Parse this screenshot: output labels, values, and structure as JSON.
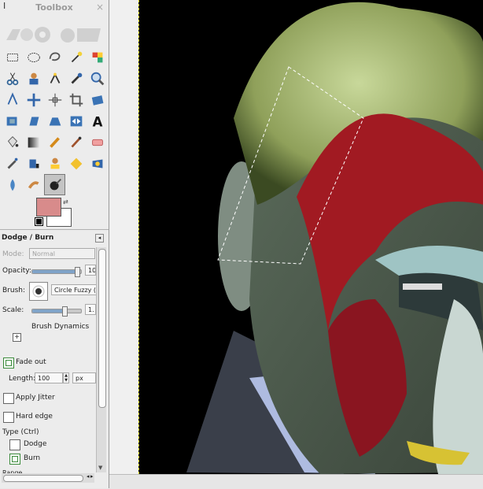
{
  "toolbox": {
    "title": "Toolbox",
    "cursor_glyph": "I",
    "close_glyph": "×",
    "tools": [
      {
        "name": "rect-select-icon"
      },
      {
        "name": "ellipse-select-icon"
      },
      {
        "name": "lasso-icon"
      },
      {
        "name": "fuzzy-select-icon"
      },
      {
        "name": "select-by-color-icon"
      },
      {
        "name": "scissors-icon"
      },
      {
        "name": "foreground-select-icon"
      },
      {
        "name": "paths-icon"
      },
      {
        "name": "color-picker-icon"
      },
      {
        "name": "zoom-icon"
      },
      {
        "name": "measure-icon"
      },
      {
        "name": "move-icon"
      },
      {
        "name": "align-icon"
      },
      {
        "name": "crop-icon"
      },
      {
        "name": "rotate-icon"
      },
      {
        "name": "scale-icon"
      },
      {
        "name": "shear-icon"
      },
      {
        "name": "perspective-icon"
      },
      {
        "name": "flip-icon"
      },
      {
        "name": "text-icon"
      },
      {
        "name": "bucket-fill-icon"
      },
      {
        "name": "blend-icon"
      },
      {
        "name": "pencil-icon"
      },
      {
        "name": "paintbrush-icon"
      },
      {
        "name": "eraser-icon"
      },
      {
        "name": "airbrush-icon"
      },
      {
        "name": "ink-icon"
      },
      {
        "name": "clone-icon"
      },
      {
        "name": "heal-icon"
      },
      {
        "name": "perspective-clone-icon"
      },
      {
        "name": "blur-icon"
      },
      {
        "name": "smudge-icon"
      },
      {
        "name": "dodge-burn-icon",
        "active": true
      }
    ],
    "colors": {
      "foreground": "#d88b8b",
      "background": "#ffffff"
    }
  },
  "options": {
    "header": "Dodge / Burn",
    "mode_label": "Mode:",
    "mode_value": "Normal",
    "opacity_label": "Opacity:",
    "opacity_value": "10",
    "brush_label": "Brush:",
    "brush_value": "Circle Fuzzy (",
    "scale_label": "Scale:",
    "scale_value": "1.",
    "dynamics_label": "Brush Dynamics",
    "fade_out_label": "Fade out",
    "fade_out_checked": true,
    "length_label": "Length:",
    "length_value": "100",
    "length_unit": "px",
    "apply_jitter_label": "Apply Jitter",
    "hard_edge_label": "Hard edge",
    "type_label": "Type  (Ctrl)",
    "dodge_label": "Dodge",
    "burn_label": "Burn",
    "burn_checked": true,
    "range_label": "Range"
  }
}
